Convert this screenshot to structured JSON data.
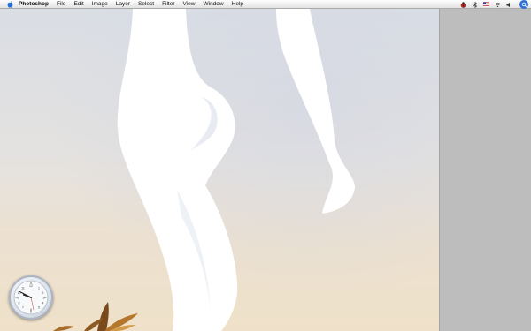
{
  "menubar": {
    "app_name": "Photoshop",
    "items": [
      "File",
      "Edit",
      "Image",
      "Layer",
      "Select",
      "Filter",
      "View",
      "Window",
      "Help"
    ]
  },
  "status_icons": [
    "ladybug-icon",
    "bluetooth-icon",
    "us-flag-icon",
    "wifi-icon",
    "volume-icon",
    "spotlight-search-icon"
  ],
  "clock_widget": {
    "time_shown": "9:42"
  }
}
